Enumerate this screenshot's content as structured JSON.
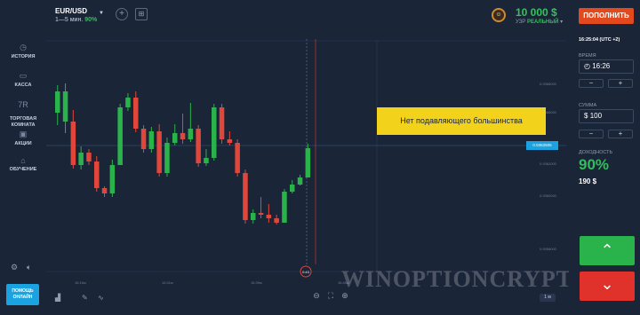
{
  "header": {
    "asset": "EUR/USD",
    "expiry": "1—5 мин.",
    "payout_pct": "90%",
    "balance": "10 000 $",
    "account_label": "УЗР",
    "account_type": "РЕАЛЬНЫЙ",
    "deposit_label": "ПОПОЛНИТЬ",
    "avatar": "☺"
  },
  "sidebar": {
    "items": [
      {
        "label": "ИСТОРИЯ",
        "icon": "history-icon"
      },
      {
        "label": "КАССА",
        "icon": "wallet-icon"
      },
      {
        "label": "ТОРГОВАЯ\nКОМНАТА",
        "icon": "trading-room-icon"
      },
      {
        "label": "АКЦИИ",
        "icon": "gift-icon"
      },
      {
        "label": "ОБУЧЕНИЕ",
        "icon": "education-icon"
      }
    ],
    "help_label_1": "ПОМОЩЬ",
    "help_label_2": "ОНЛАЙН"
  },
  "chart": {
    "banner": "Нет подавляющего большинства",
    "price_tag": "0.9362506",
    "price_labels": [
      "0.9368000",
      "0.9366000",
      "0.9362000",
      "0.9360000",
      "0.9358000"
    ],
    "time_labels": [
      "16:16м",
      "16:31м",
      "16:39м",
      "16:45м"
    ],
    "timer": "0:43",
    "zoom": "1 м",
    "colors": {
      "up": "#2ab34a",
      "down": "#e0463a",
      "bg": "#1b2538"
    }
  },
  "chart_data": {
    "type": "candlestick",
    "candles": [
      [
        127,
        103,
        141,
        96
      ],
      [
        137,
        103,
        150,
        94
      ],
      [
        137,
        186,
        190,
        124
      ],
      [
        186,
        172,
        191,
        165
      ],
      [
        172,
        182,
        186,
        168
      ],
      [
        182,
        212,
        216,
        176
      ],
      [
        212,
        218,
        222,
        210
      ],
      [
        218,
        186,
        222,
        180
      ],
      [
        186,
        121,
        186,
        117
      ],
      [
        121,
        110,
        125,
        105
      ],
      [
        110,
        145,
        149,
        103
      ],
      [
        145,
        168,
        172,
        141
      ],
      [
        168,
        148,
        172,
        143
      ],
      [
        148,
        195,
        199,
        140
      ],
      [
        195,
        161,
        199,
        155
      ],
      [
        161,
        150,
        164,
        140
      ],
      [
        150,
        157,
        162,
        128
      ],
      [
        157,
        145,
        160,
        116
      ],
      [
        145,
        184,
        188,
        141
      ],
      [
        184,
        178,
        187,
        168
      ],
      [
        178,
        121,
        181,
        117
      ],
      [
        121,
        157,
        162,
        117
      ],
      [
        157,
        161,
        164,
        148
      ],
      [
        161,
        195,
        199,
        157
      ],
      [
        195,
        248,
        252,
        191
      ],
      [
        248,
        240,
        252,
        236
      ],
      [
        240,
        242,
        246,
        222
      ],
      [
        242,
        246,
        251,
        230
      ],
      [
        246,
        251,
        253,
        242
      ],
      [
        251,
        216,
        251,
        213
      ],
      [
        216,
        208,
        218,
        203
      ],
      [
        208,
        200,
        209,
        197
      ],
      [
        200,
        167,
        200,
        162
      ]
    ]
  },
  "right_panel": {
    "clock": "16:25:04 (UTC +2)",
    "time_label": "ВРЕМЯ",
    "time_value": "16:26",
    "amount_label": "СУММА",
    "amount_value": "100",
    "currency": "$",
    "minus": "−",
    "plus": "+",
    "payout_label": "ДОХОДНОСТЬ",
    "payout_value": "90%",
    "profit_value": "190 $",
    "call_symbol": "⌃",
    "put_symbol": "⌄"
  },
  "watermark": "WINOPTIONCRYPTO.COM"
}
